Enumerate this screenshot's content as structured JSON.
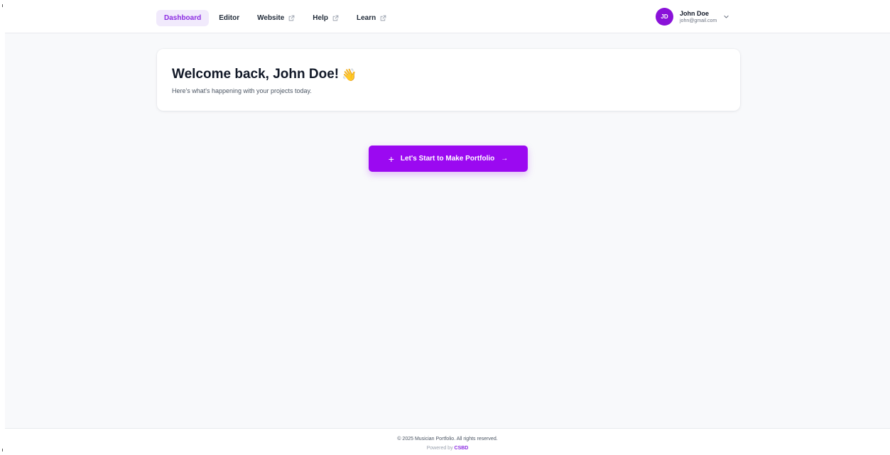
{
  "nav": {
    "tabs": [
      {
        "label": "Dashboard",
        "active": true,
        "external": false
      },
      {
        "label": "Editor",
        "active": false,
        "external": false
      },
      {
        "label": "Website",
        "active": false,
        "external": true
      },
      {
        "label": "Help",
        "active": false,
        "external": true
      },
      {
        "label": "Learn",
        "active": false,
        "external": true
      }
    ]
  },
  "user": {
    "initials": "JD",
    "name": "John Doe",
    "email": "john@gmail.com",
    "menu_icon": "chevron-down-icon"
  },
  "welcome": {
    "title": "Welcome back, John Doe!",
    "emoji": "👋",
    "subtitle": "Here's what's happening with your projects today."
  },
  "cta": {
    "label": "Let's Start to Make Portfolio",
    "leading_icon": "plus-icon",
    "trailing_icon": "arrow-right-icon"
  },
  "footer": {
    "copyright": "© 2025 Musician Portfolio. All rights reserved.",
    "powered_prefix": "Powered by",
    "powered_brand": "CSBD"
  },
  "colors": {
    "accent": "#9b09f1",
    "avatar": "#8a12d9",
    "active_tab_bg": "#f1eafc",
    "page_bg": "#f8f9fb"
  }
}
